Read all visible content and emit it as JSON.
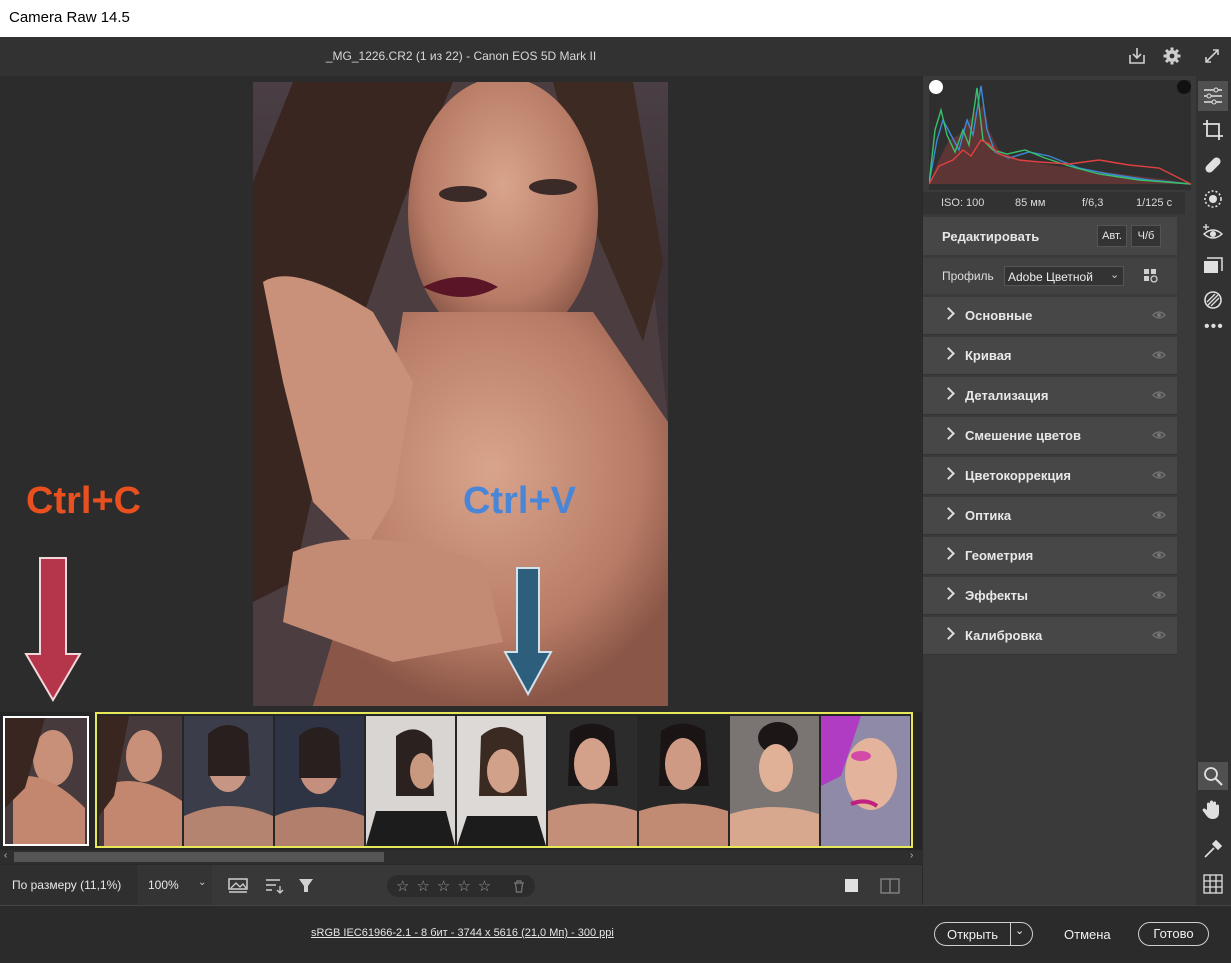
{
  "window": {
    "title": "Camera Raw 14.5"
  },
  "header": {
    "file_info": "_MG_1226.CR2 (1 из 22)  -  Canon EOS 5D Mark II"
  },
  "exif": {
    "iso": "ISO: 100",
    "focal": "85 мм",
    "aperture": "f/6,3",
    "shutter": "1/125 с"
  },
  "edit": {
    "title": "Редактировать",
    "auto_label": "Авт.",
    "bw_label": "Ч/б",
    "profile_label": "Профиль",
    "profile_value": "Adobe Цветной"
  },
  "sections": [
    "Основные",
    "Кривая",
    "Детализация",
    "Смешение цветов",
    "Цветокоррекция",
    "Оптика",
    "Геометрия",
    "Эффекты",
    "Калибровка"
  ],
  "annotations": {
    "copy": "Ctrl+C",
    "paste": "Ctrl+V",
    "copy_color": "#e8501f",
    "paste_color": "#4a86d8"
  },
  "toolbar": {
    "fit_label": "По размеру (11,1%)",
    "zoom_label": "100%"
  },
  "status": {
    "file_details": "sRGB IEC61966-2.1 - 8 бит - 3744 x 5616 (21,0 Мп) - 300 ppi"
  },
  "buttons": {
    "open": "Открыть",
    "cancel": "Отмена",
    "done": "Готово"
  },
  "colors": {
    "selection_yellow": "#e6e85a",
    "accent": "#ffffff"
  }
}
